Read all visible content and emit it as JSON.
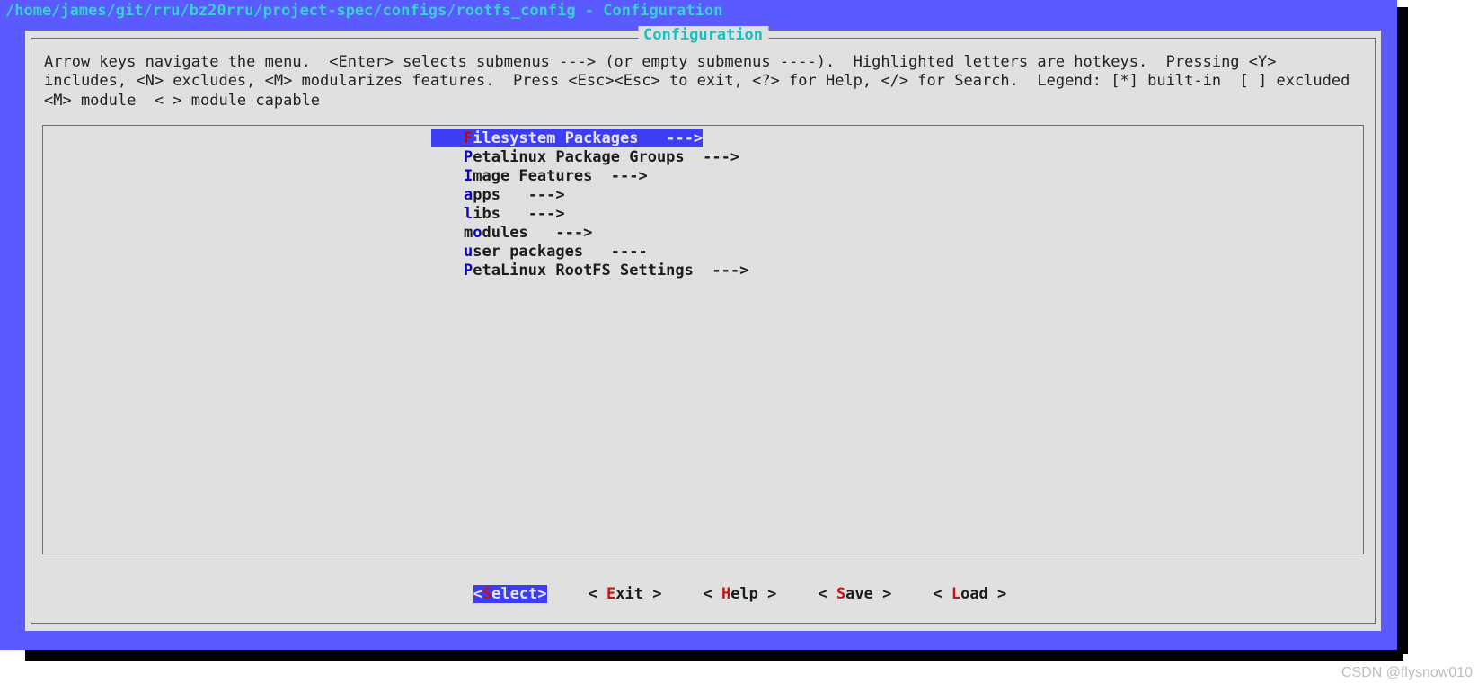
{
  "title": {
    "path": "/home/james/git/rru/bz20rru/project-spec/configs/rootfs_config",
    "sep": " - ",
    "name": "Configuration"
  },
  "group_title": "Configuration",
  "help_text": "Arrow keys navigate the menu.  <Enter> selects submenus ---> (or empty submenus ----).  Highlighted letters are hotkeys.  Pressing <Y> includes, <N> excludes, <M> modularizes features.  Press <Esc><Esc> to exit, <?> for Help, </> for Search.  Legend: [*] built-in  [ ] excluded  <M> module  < > module capable",
  "menu": {
    "items": [
      {
        "pre": "F",
        "rest": "ilesystem Packages",
        "arrow": "--->",
        "pad": "   ",
        "selected": true
      },
      {
        "pre": "P",
        "rest": "etalinux Package Groups",
        "arrow": "--->",
        "pad": "  ",
        "selected": false
      },
      {
        "pre": "I",
        "rest": "mage Features",
        "arrow": "--->",
        "pad": "  ",
        "selected": false
      },
      {
        "pre": "a",
        "rest": "pps",
        "arrow": "--->",
        "pad": "   ",
        "selected": false
      },
      {
        "pre": "l",
        "rest": "ibs",
        "arrow": "--->",
        "pad": "   ",
        "selected": false
      },
      {
        "pre": "o",
        "rest": "dules",
        "arrow": "--->",
        "pad": "   ",
        "selected": false,
        "pre2": "m"
      },
      {
        "pre": "u",
        "rest": "ser packages",
        "arrow": "----",
        "pad": "   ",
        "selected": false
      },
      {
        "pre": "P",
        "rest": "etaLinux RootFS Settings",
        "arrow": "--->",
        "pad": "  ",
        "selected": false
      }
    ]
  },
  "buttons": {
    "select": {
      "open": "<",
      "hot": "S",
      "rest": "elect",
      "close": ">"
    },
    "exit": {
      "open": "< ",
      "hot": "E",
      "rest": "xit",
      "close": " >"
    },
    "help": {
      "open": "< ",
      "hot": "H",
      "rest": "elp",
      "close": " >"
    },
    "save": {
      "open": "< ",
      "hot": "S",
      "rest": "ave",
      "close": " >"
    },
    "load": {
      "open": "< ",
      "hot": "L",
      "rest": "oad",
      "close": " >"
    }
  },
  "watermark": "CSDN @flysnow010"
}
